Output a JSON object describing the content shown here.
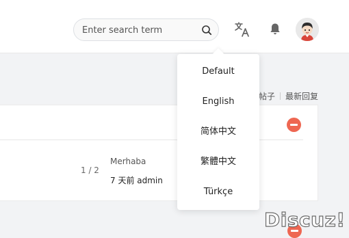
{
  "header": {
    "search": {
      "placeholder": "Enter search term",
      "value": ""
    },
    "icons": {
      "search": "search-icon",
      "language": "translate-icon",
      "notifications": "bell-icon",
      "avatar": "user-avatar"
    }
  },
  "language_menu": {
    "items": [
      {
        "label": "Default"
      },
      {
        "label": "English"
      },
      {
        "label": "简体中文"
      },
      {
        "label": "繁體中文"
      },
      {
        "label": "Türkçe"
      }
    ]
  },
  "sort_bar": {
    "items": [
      "帖子",
      "最新回复"
    ]
  },
  "thread": {
    "pages": "1 / 2",
    "last_post_title": "Merhaba",
    "last_post_meta": "7 天前 admin"
  },
  "logo": {
    "text": "Discuz!"
  },
  "colors": {
    "accent_red": "#ee6752",
    "background": "#f2f3f5",
    "card": "#ffffff"
  }
}
